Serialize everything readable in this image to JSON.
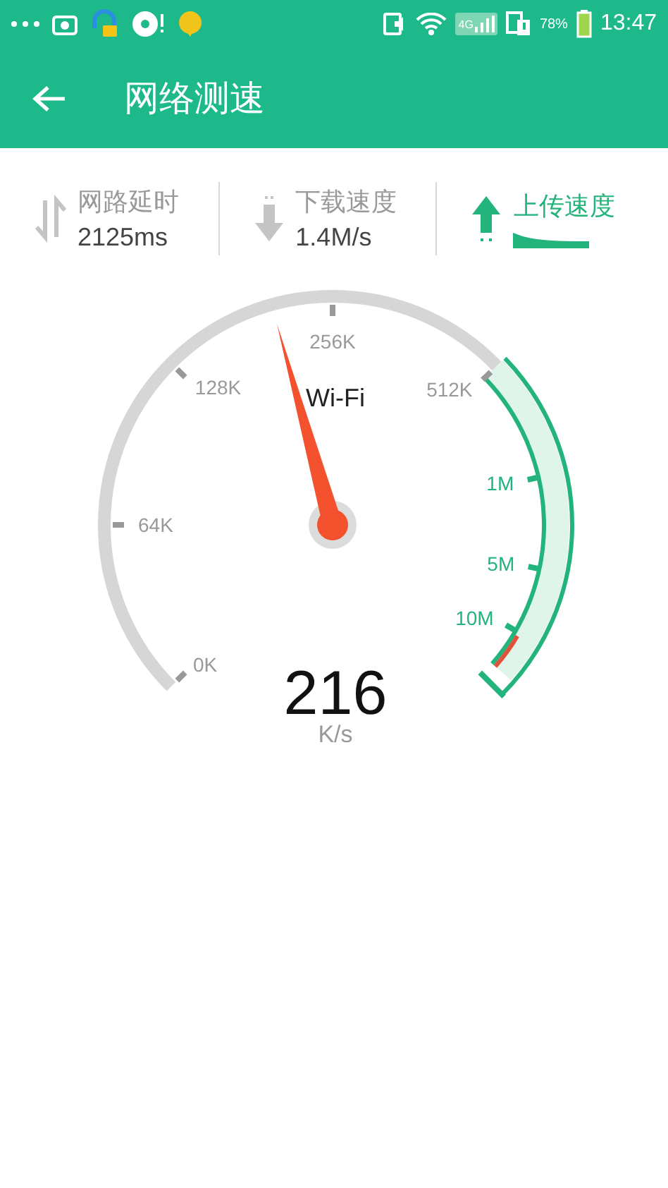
{
  "status_bar": {
    "network": "4G",
    "battery_percent": "78%",
    "time": "13:47"
  },
  "app_bar": {
    "title": "网络测速"
  },
  "tabs": [
    {
      "kind": "latency",
      "label": "网路延时",
      "value": "2125ms",
      "selected": false
    },
    {
      "kind": "download",
      "label": "下载速度",
      "value": "1.4M/s",
      "selected": false
    },
    {
      "kind": "upload",
      "label": "上传速度",
      "selected": true
    }
  ],
  "gauge": {
    "network": "Wi-Fi",
    "value": "216",
    "unit": "K/s",
    "scale": [
      {
        "label": "0K",
        "color": "#999999"
      },
      {
        "label": "64K",
        "color": "#999999"
      },
      {
        "label": "128K",
        "color": "#999999"
      },
      {
        "label": "256K",
        "color": "#999999"
      },
      {
        "label": "512K",
        "color": "#999999"
      },
      {
        "label": "1M",
        "color": "#22b47c"
      },
      {
        "label": "5M",
        "color": "#22b47c"
      },
      {
        "label": "10M",
        "color": "#22b47c"
      }
    ]
  }
}
